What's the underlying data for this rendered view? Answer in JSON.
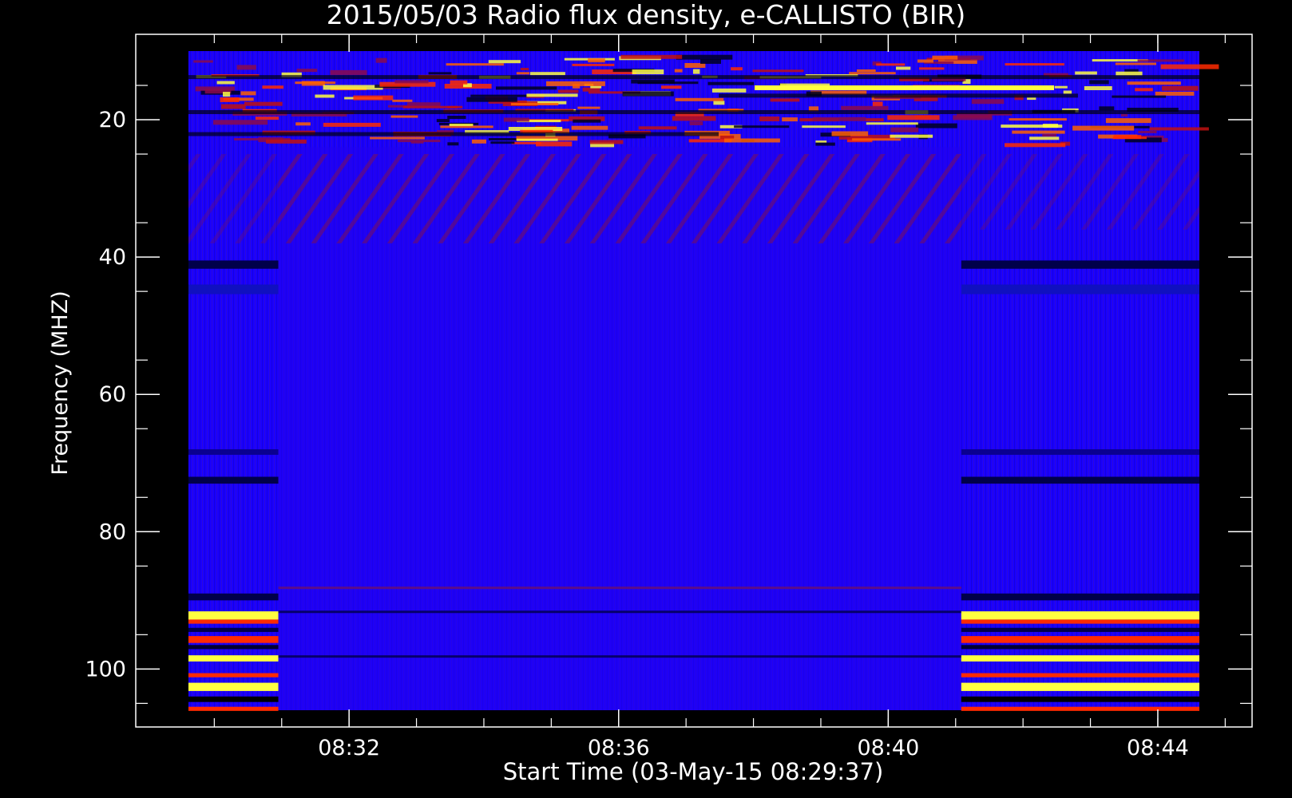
{
  "chart_data": {
    "type": "heatmap",
    "title": "2015/05/03  Radio flux density, e-CALLISTO (BIR)",
    "xlabel": "Start Time (03-May-15 08:29:37)",
    "ylabel": "Frequency (MHZ)",
    "x_ticks": [
      "08:32",
      "08:36",
      "08:40",
      "08:44"
    ],
    "y_ticks": [
      "20",
      "40",
      "60",
      "80",
      "100"
    ],
    "x_range_minutes": [
      8.62,
      8.75
    ],
    "x_range": [
      "08:29:37",
      "08:45:00"
    ],
    "y_range": [
      108,
      10
    ],
    "data_span": {
      "x": [
        "08:29:37",
        "08:44:37"
      ],
      "y": [
        106,
        10
      ]
    },
    "colors": {
      "background": "#000000",
      "axis": "#ffffff",
      "low": "#1a00ff",
      "mid": "#8b0a4b",
      "high": "#ff2a00",
      "peak": "#ffff40",
      "dark_band": "#00004a"
    }
  }
}
